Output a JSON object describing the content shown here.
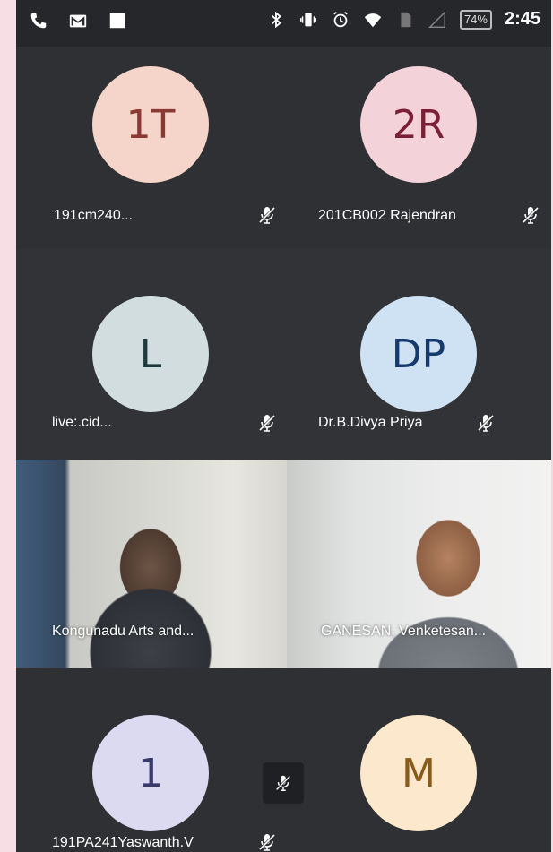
{
  "status_bar": {
    "battery": "74%",
    "time": "2:45"
  },
  "participants": [
    {
      "initials": "1T",
      "name": "191cm240...",
      "avatar_bg": "#f5d5c9",
      "avatar_fg": "#8a3a32",
      "muted": true
    },
    {
      "initials": "2R",
      "name": "201CB002 Rajendran",
      "avatar_bg": "#f3d2da",
      "avatar_fg": "#7a1f36",
      "muted": true
    },
    {
      "initials": "L",
      "name": "live:.cid...",
      "avatar_bg": "#d2dde0",
      "avatar_fg": "#1f3a3e",
      "muted": true
    },
    {
      "initials": "DP",
      "name": "Dr.B.Divya Priya",
      "avatar_bg": "#cfe2f3",
      "avatar_fg": "#173a6e",
      "muted": true
    },
    {
      "initials": "1",
      "name": "191PA241Yaswanth.V",
      "avatar_bg": "#dcdaf0",
      "avatar_fg": "#3a3a6a",
      "muted": true
    },
    {
      "initials": "M",
      "name": "",
      "avatar_bg": "#fbe8cd",
      "avatar_fg": "#8a5a1a",
      "muted": false
    }
  ],
  "video_tiles": [
    {
      "name": "Kongunadu Arts and..."
    },
    {
      "name": "GANESAN, Venketesan..."
    }
  ],
  "colors": {
    "tile_dark": "#2f3033",
    "tile_darker": "#262729"
  }
}
